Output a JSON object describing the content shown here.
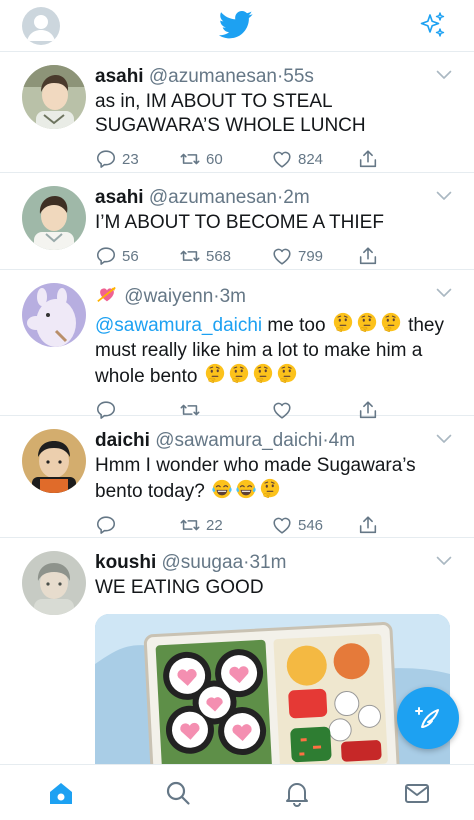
{
  "colors": {
    "brand": "#1da1f2",
    "text": "#14171a",
    "muted": "#657786",
    "divider": "#e6ecf0"
  },
  "header": {
    "logo_icon": "twitter-bird-icon",
    "right_icon": "sparkle-icon",
    "left_icon": "profile-avatar"
  },
  "tweets": [
    {
      "name": "asahi",
      "handle": "@azumanesan",
      "dot": "·",
      "time": "55s",
      "text": "as in, IM ABOUT TO STEAL SUGAWARA’S WHOLE LUNCH",
      "replies": "23",
      "retweets": "60",
      "likes": "824"
    },
    {
      "name": "asahi",
      "handle": "@azumanesan",
      "dot": "·",
      "time": "2m",
      "text": "I’M ABOUT TO BECOME A THIEF",
      "replies": "56",
      "retweets": "568",
      "likes": "799"
    },
    {
      "name_emoji": "heart-with-arrow-emoji",
      "handle": "@waiyenn",
      "dot": "·",
      "time": "3m",
      "mention": "@sawamura_daichi",
      "text_a": " me too ",
      "text_b": " they must really like him a lot to make him a whole bento ",
      "emoji": "thinking-face-emoji"
    },
    {
      "name": "daichi",
      "handle": "@sawamura_daichi",
      "dot": "·",
      "time": "4m",
      "text": "Hmm I wonder who made Sugawara’s bento today? ",
      "emoji_a": "tears-of-joy-emoji",
      "emoji_b": "thinking-face-emoji",
      "retweets": "22",
      "likes": "546"
    },
    {
      "name": "koushi",
      "handle": "@suugaa",
      "dot": "·",
      "time": "31m",
      "text": "WE EATING GOOD",
      "media": "bento-box-image"
    }
  ],
  "compose": {
    "icon": "compose-feather-icon"
  },
  "tabs": [
    {
      "icon": "home-icon",
      "active": true
    },
    {
      "icon": "search-icon",
      "active": false
    },
    {
      "icon": "notifications-bell-icon",
      "active": false
    },
    {
      "icon": "messages-envelope-icon",
      "active": false
    }
  ]
}
